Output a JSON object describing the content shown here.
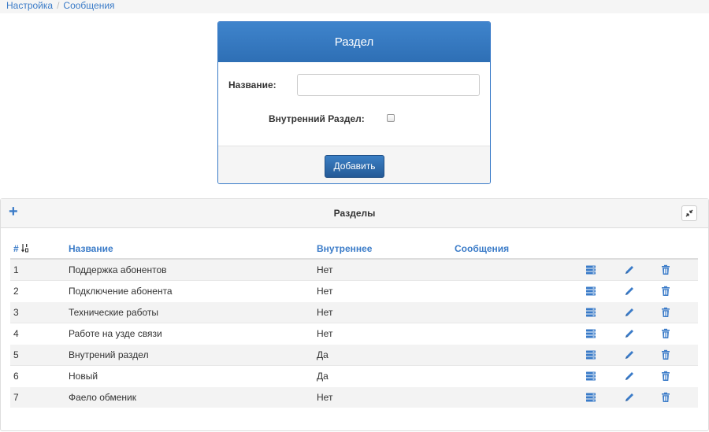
{
  "breadcrumb": {
    "item1": "Настройка",
    "separator": "/",
    "item2": "Сообщения"
  },
  "form": {
    "title": "Раздел",
    "name_label": "Название:",
    "name_value": "",
    "internal_label": "Внутренний Раздел:",
    "internal_checked": false,
    "submit_label": "Добавить"
  },
  "list": {
    "title": "Разделы",
    "add_icon": "plus-icon",
    "collapse_icon": "compress-icon",
    "columns": {
      "num": "#",
      "name": "Название",
      "internal": "Внутреннее",
      "messages": "Сообщения"
    },
    "rows": [
      {
        "num": "1",
        "name": "Поддержка абонентов",
        "internal": "Нет"
      },
      {
        "num": "2",
        "name": "Подключение абонента",
        "internal": "Нет"
      },
      {
        "num": "3",
        "name": "Технические работы",
        "internal": "Нет"
      },
      {
        "num": "4",
        "name": "Работе на узде связи",
        "internal": "Нет"
      },
      {
        "num": "5",
        "name": "Внутрений раздел",
        "internal": "Да"
      },
      {
        "num": "6",
        "name": "Новый",
        "internal": "Да"
      },
      {
        "num": "7",
        "name": "Фаело обменик",
        "internal": "Нет"
      }
    ],
    "row_actions": [
      "list-icon",
      "pencil-icon",
      "trash-icon"
    ]
  },
  "colors": {
    "accent": "#3a7bc8",
    "header_blue": "#2e6fb5",
    "button_blue": "#245a97"
  }
}
